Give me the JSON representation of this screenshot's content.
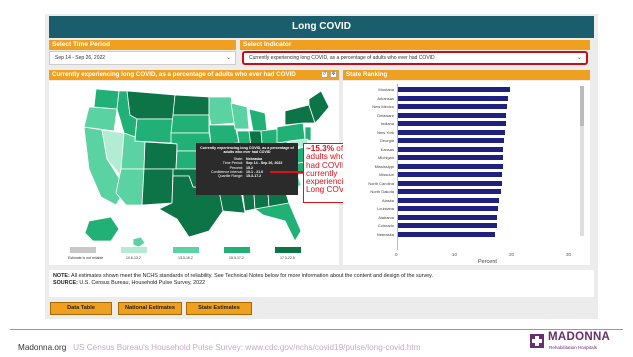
{
  "dashboard": {
    "title": "Long COVID",
    "time_period": {
      "label": "Select Time Period",
      "value": "Sep 14 - Sep 26, 2022"
    },
    "indicator": {
      "label": "Select Indicator",
      "value": "Currently experiencing long COVID, as a percentage of adults who ever had COVID"
    }
  },
  "map_panel": {
    "heading": "Currently experiencing long COVID, as a percentage of adults who ever had COVID",
    "legend": [
      {
        "label": "Estimate is not reliable",
        "color": "#c8c8c8"
      },
      {
        "label": "10.6-13.2",
        "color": "#b2ecd3"
      },
      {
        "label": "13.3-15.2",
        "color": "#5ad2a2"
      },
      {
        "label": "15.3-17.2",
        "color": "#21b176"
      },
      {
        "label": "17.3-22.5",
        "color": "#0c7447"
      }
    ],
    "tooltip": {
      "title": "Currently experiencing long COVID, as a percentage of adults who ever had COVID",
      "rows": [
        {
          "k": "State:",
          "v": "Nebraska"
        },
        {
          "k": "Time Period:",
          "v": "Sep 14 - Sep 26, 2022"
        },
        {
          "k": "Percent:",
          "v": "15.2"
        },
        {
          "k": "Confidence Interval:",
          "v": "10.1 - 21.0"
        },
        {
          "k": "Quartile Range:",
          "v": "15.3-17.2"
        }
      ]
    },
    "callout": {
      "highlight": "~15.3%",
      "text": "of adults who had COVID, currently experiencing Long COVID"
    }
  },
  "ranking_panel": {
    "heading": "State Ranking",
    "axis_title": "Percent",
    "axis_ticks": [
      "0",
      "10",
      "20",
      "30"
    ],
    "bar_color": "#1f2080"
  },
  "chart_data": {
    "type": "bar",
    "orientation": "horizontal",
    "title": "State Ranking",
    "xlabel": "Percent",
    "xlim": [
      0,
      30
    ],
    "categories": [
      "Montana",
      "Arkansas",
      "New Mexico",
      "Delaware",
      "Indiana",
      "New York",
      "Georgia",
      "Kansas",
      "Michigan",
      "Mississippi",
      "Missouri",
      "North Carolina",
      "North Dakota",
      "Alaska",
      "Louisiana",
      "Alabama",
      "Colorado",
      "Nebraska"
    ],
    "values": [
      19.6,
      19.3,
      19.2,
      19.0,
      18.9,
      18.8,
      18.6,
      18.5,
      18.5,
      18.4,
      18.3,
      18.2,
      18.1,
      17.8,
      17.6,
      17.4,
      17.3,
      17.1
    ]
  },
  "notes": {
    "note_label": "NOTE:",
    "note_text": "All estimates shown meet the NCHS standards of reliability. See Technical Notes below for more information about the content and design of the survey.",
    "source_label": "SOURCE:",
    "source_text": "U.S. Census Bureau, Household Pulse Survey, 2022"
  },
  "buttons": {
    "data_table": "Data Table",
    "national": "National Estimates",
    "state": "State Estimates"
  },
  "footer": {
    "site": "Madonna.org",
    "source": "US Census Bureau's Household Pulse Survey: www.cdc.gov/nchs/covid19/pulse/long-covid.htm",
    "logo_name": "MADONNA",
    "logo_sub": "Rehabilitation Hospitals"
  }
}
